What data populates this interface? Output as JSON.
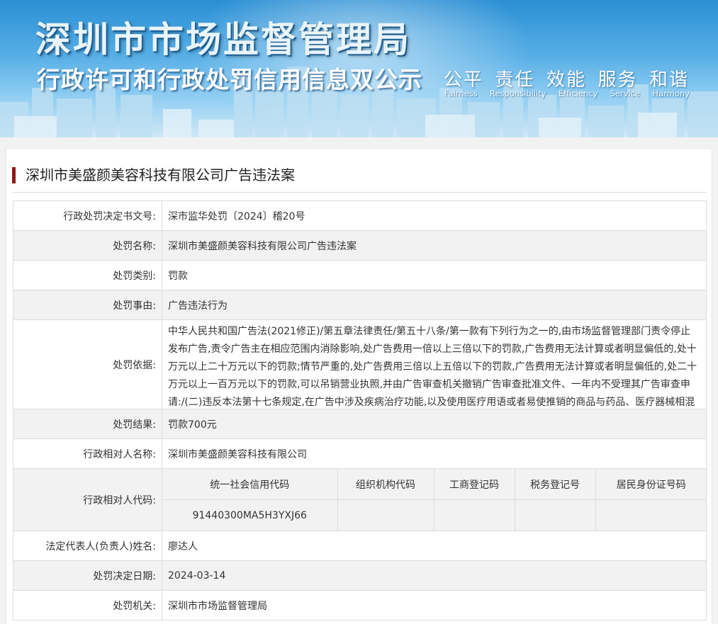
{
  "banner": {
    "title": "深圳市市场监督管理局",
    "subtitle": "行政许可和行政处罚信用信息双公示",
    "slogans_zh": [
      "公平",
      "责任",
      "效能",
      "服务",
      "和谐"
    ],
    "slogans_en": [
      "Fairness",
      "Responsibility",
      "Efficiency",
      "Service",
      "Harmony"
    ]
  },
  "case": {
    "heading": "深圳市美盛颜美容科技有限公司广告违法案",
    "accent_color": "#8b1a1a",
    "rows": [
      {
        "label": "行政处罚决定书文号:",
        "value": "深市监华处罚〔2024〕稽20号"
      },
      {
        "label": "处罚名称:",
        "value": "深圳市美盛颜美容科技有限公司广告违法案"
      },
      {
        "label": "处罚类别:",
        "value": "罚款"
      },
      {
        "label": "处罚事由:",
        "value": "广告违法行为"
      },
      {
        "label": "处罚依据:",
        "value": "中华人民共和国广告法(2021修正)/第五章法律责任/第五十八条/第一款有下列行为之一的,由市场监督管理部门责令停止发布广告,责令广告主在相应范围内消除影响,处广告费用一倍以上三倍以下的罚款,广告费用无法计算或者明显偏低的,处十万元以上二十万元以下的罚款;情节严重的,处广告费用三倍以上五倍以下的罚款,广告费用无法计算或者明显偏低的,处二十万元以上一百万元以下的罚款,可以吊销营业执照,并由广告审查机关撤销广告审查批准文件、一年内不受理其广告审查申请:/(二)违反本法第十七条规定,在广告中涉及疾病治疗功能,以及使用医疗用语或者易使推销的商品与药品、医疗器械相混淆的用语的;"
      },
      {
        "label": "处罚结果:",
        "value": "罚款700元"
      },
      {
        "label": "行政相对人名称:",
        "value": "深圳市美盛颜美容科技有限公司"
      }
    ],
    "codes": {
      "label": "行政相对人代码:",
      "headers": [
        "统一社会信用代码",
        "组织机构代码",
        "工商登记码",
        "税务登记号",
        "居民身份证号码"
      ],
      "values": [
        "91440300MA5H3YXJ66",
        "",
        "",
        "",
        ""
      ]
    },
    "rows_after": [
      {
        "label": "法定代表人(负责人)姓名:",
        "value": "廖达人"
      },
      {
        "label": "处罚决定日期:",
        "value": "2024-03-14"
      },
      {
        "label": "处罚机关:",
        "value": "深圳市市场监督管理局"
      }
    ]
  }
}
